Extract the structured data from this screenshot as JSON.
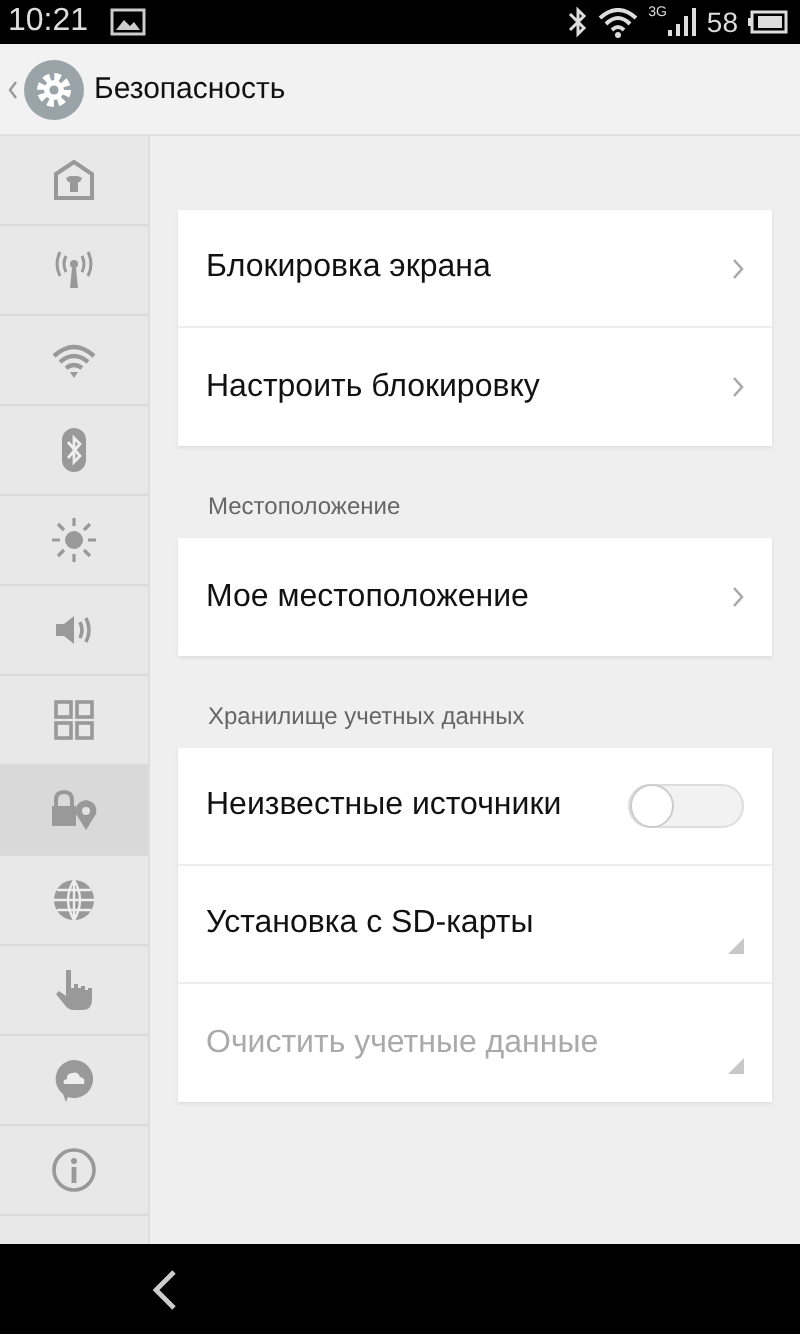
{
  "status_bar": {
    "time": "10:21",
    "network": "3G",
    "battery": "58"
  },
  "header": {
    "title": "Безопасность"
  },
  "sidebar": {
    "items": [
      {
        "selected": false
      },
      {
        "selected": false
      },
      {
        "selected": false
      },
      {
        "selected": false
      },
      {
        "selected": false
      },
      {
        "selected": false
      },
      {
        "selected": false
      },
      {
        "selected": true
      },
      {
        "selected": false
      },
      {
        "selected": false
      },
      {
        "selected": false
      },
      {
        "selected": false
      }
    ]
  },
  "sections": [
    {
      "rows": [
        {
          "kind": "link",
          "label": "Блокировка экрана",
          "disabled": false
        },
        {
          "kind": "link",
          "label": "Настроить блокировку",
          "disabled": false
        }
      ]
    },
    {
      "title": "Местоположение",
      "rows": [
        {
          "kind": "link",
          "label": "Мое местоположение",
          "disabled": false
        }
      ]
    },
    {
      "title": "Хранилище учетных данных",
      "rows": [
        {
          "kind": "toggle",
          "label": "Неизвестные источники",
          "on": false,
          "disabled": false
        },
        {
          "kind": "menu",
          "label": "Установка с SD-карты",
          "disabled": false
        },
        {
          "kind": "menu",
          "label": "Очистить учетные данные",
          "disabled": true
        }
      ]
    }
  ]
}
